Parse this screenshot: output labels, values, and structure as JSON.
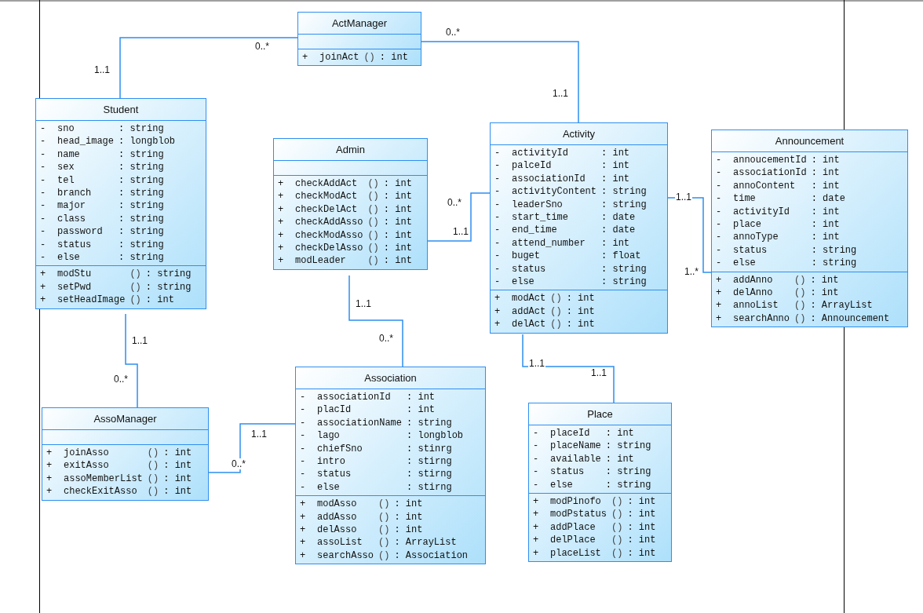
{
  "classes": [
    {
      "name": "ActManager",
      "operations": [
        {
          "visibility": "+",
          "name": "joinAct",
          "params": "()",
          "type": ": int"
        }
      ]
    },
    {
      "name": "Student",
      "attributes": [
        {
          "visibility": "-",
          "name": "sno",
          "type": ": string"
        },
        {
          "visibility": "-",
          "name": "head_image",
          "type": ": longblob"
        },
        {
          "visibility": "-",
          "name": "name",
          "type": ": string"
        },
        {
          "visibility": "-",
          "name": "sex",
          "type": ": string"
        },
        {
          "visibility": "-",
          "name": "tel",
          "type": ": string"
        },
        {
          "visibility": "-",
          "name": "branch",
          "type": ": string"
        },
        {
          "visibility": "-",
          "name": "major",
          "type": ": string"
        },
        {
          "visibility": "-",
          "name": "class",
          "type": ": string"
        },
        {
          "visibility": "-",
          "name": "password",
          "type": ": string"
        },
        {
          "visibility": "-",
          "name": "status",
          "type": ": string"
        },
        {
          "visibility": "-",
          "name": "else",
          "type": ": string"
        }
      ],
      "operations": [
        {
          "visibility": "+",
          "name": "modStu",
          "params": "()",
          "type": ": string"
        },
        {
          "visibility": "+",
          "name": "setPwd",
          "params": "()",
          "type": ": string"
        },
        {
          "visibility": "+",
          "name": "setHeadImage",
          "params": "()",
          "type": ": int"
        }
      ]
    },
    {
      "name": "Admin",
      "operations": [
        {
          "visibility": "+",
          "name": "checkAddAct",
          "params": "()",
          "type": ": int"
        },
        {
          "visibility": "+",
          "name": "checkModAct",
          "params": "()",
          "type": ": int"
        },
        {
          "visibility": "+",
          "name": "checkDelAct",
          "params": "()",
          "type": ": int"
        },
        {
          "visibility": "+",
          "name": "checkAddAsso",
          "params": "()",
          "type": ": int"
        },
        {
          "visibility": "+",
          "name": "checkModAsso",
          "params": "()",
          "type": ": int"
        },
        {
          "visibility": "+",
          "name": "checkDelAsso",
          "params": "()",
          "type": ": int"
        },
        {
          "visibility": "+",
          "name": "modLeader",
          "params": "()",
          "type": ": int"
        }
      ]
    },
    {
      "name": "Activity",
      "attributes": [
        {
          "visibility": "-",
          "name": "activityId",
          "type": ": int"
        },
        {
          "visibility": "-",
          "name": "palceId",
          "type": ": int"
        },
        {
          "visibility": "-",
          "name": "associationId",
          "type": ": int"
        },
        {
          "visibility": "-",
          "name": "activityContent",
          "type": ": string"
        },
        {
          "visibility": "-",
          "name": "leaderSno",
          "type": ": string"
        },
        {
          "visibility": "-",
          "name": "start_time",
          "type": ": date"
        },
        {
          "visibility": "-",
          "name": "end_time",
          "type": ": date"
        },
        {
          "visibility": "-",
          "name": "attend_number",
          "type": ": int"
        },
        {
          "visibility": "-",
          "name": "buget",
          "type": ": float"
        },
        {
          "visibility": "-",
          "name": "status",
          "type": ": string"
        },
        {
          "visibility": "-",
          "name": "else",
          "type": ": string"
        }
      ],
      "operations": [
        {
          "visibility": "+",
          "name": "modAct",
          "params": "()",
          "type": ": int"
        },
        {
          "visibility": "+",
          "name": "addAct",
          "params": "()",
          "type": ": int"
        },
        {
          "visibility": "+",
          "name": "delAct",
          "params": "()",
          "type": ": int"
        }
      ]
    },
    {
      "name": "Announcement",
      "attributes": [
        {
          "visibility": "-",
          "name": "annoucementId",
          "type": ": int"
        },
        {
          "visibility": "-",
          "name": "associationId",
          "type": ": int"
        },
        {
          "visibility": "-",
          "name": "annoContent",
          "type": ": int"
        },
        {
          "visibility": "-",
          "name": "time",
          "type": ": date"
        },
        {
          "visibility": "-",
          "name": "activityId",
          "type": ": int"
        },
        {
          "visibility": "-",
          "name": "place",
          "type": ": int"
        },
        {
          "visibility": "-",
          "name": "annoType",
          "type": ": int"
        },
        {
          "visibility": "-",
          "name": "status",
          "type": ": string"
        },
        {
          "visibility": "-",
          "name": "else",
          "type": ": string"
        }
      ],
      "operations": [
        {
          "visibility": "+",
          "name": "addAnno",
          "params": "()",
          "type": ": int"
        },
        {
          "visibility": "+",
          "name": "delAnno",
          "params": "()",
          "type": ": int"
        },
        {
          "visibility": "+",
          "name": "annoList",
          "params": "()",
          "type": ": ArrayList"
        },
        {
          "visibility": "+",
          "name": "searchAnno",
          "params": "()",
          "type": ": Announcement"
        }
      ]
    },
    {
      "name": "AssoManager",
      "operations": [
        {
          "visibility": "+",
          "name": "joinAsso",
          "params": "()",
          "type": ": int"
        },
        {
          "visibility": "+",
          "name": "exitAsso",
          "params": "()",
          "type": ": int"
        },
        {
          "visibility": "+",
          "name": "assoMemberList",
          "params": "()",
          "type": ": int"
        },
        {
          "visibility": "+",
          "name": "checkExitAsso",
          "params": "()",
          "type": ": int"
        }
      ]
    },
    {
      "name": "Association",
      "attributes": [
        {
          "visibility": "-",
          "name": "associationId",
          "type": ": int"
        },
        {
          "visibility": "-",
          "name": "placId",
          "type": ": int"
        },
        {
          "visibility": "-",
          "name": "associationName",
          "type": ": string"
        },
        {
          "visibility": "-",
          "name": "lago",
          "type": ": longblob"
        },
        {
          "visibility": "-",
          "name": "chiefSno",
          "type": ": stinrg"
        },
        {
          "visibility": "-",
          "name": "intro",
          "type": ": stirng"
        },
        {
          "visibility": "-",
          "name": "status",
          "type": ": stirng"
        },
        {
          "visibility": "-",
          "name": "else",
          "type": ": stirng"
        }
      ],
      "operations": [
        {
          "visibility": "+",
          "name": "modAsso",
          "params": "()",
          "type": ": int"
        },
        {
          "visibility": "+",
          "name": "addAsso",
          "params": "()",
          "type": ": int"
        },
        {
          "visibility": "+",
          "name": "delAsso",
          "params": "()",
          "type": ": int"
        },
        {
          "visibility": "+",
          "name": "assoList",
          "params": "()",
          "type": ": ArrayList"
        },
        {
          "visibility": "+",
          "name": "searchAsso",
          "params": "()",
          "type": ": Association"
        }
      ]
    },
    {
      "name": "Place",
      "attributes": [
        {
          "visibility": "-",
          "name": "placeId",
          "type": ": int"
        },
        {
          "visibility": "-",
          "name": "placeName",
          "type": ": string"
        },
        {
          "visibility": "-",
          "name": "available",
          "type": ": int"
        },
        {
          "visibility": "-",
          "name": "status",
          "type": ": string"
        },
        {
          "visibility": "-",
          "name": "else",
          "type": ": string"
        }
      ],
      "operations": [
        {
          "visibility": "+",
          "name": "modPinofo",
          "params": "()",
          "type": ": int"
        },
        {
          "visibility": "+",
          "name": "modPstatus",
          "params": "()",
          "type": ": int"
        },
        {
          "visibility": "+",
          "name": "addPlace",
          "params": "()",
          "type": ": int"
        },
        {
          "visibility": "+",
          "name": "delPlace",
          "params": "()",
          "type": ": int"
        },
        {
          "visibility": "+",
          "name": "placeList",
          "params": "()",
          "type": ": int"
        }
      ]
    }
  ],
  "associations": [
    {
      "multiplicities": [
        "1..1",
        "0..*"
      ]
    },
    {
      "multiplicities": [
        "0..*",
        "1..1"
      ]
    },
    {
      "multiplicities": [
        "0..*",
        "1..1"
      ]
    },
    {
      "multiplicities": [
        "1..1",
        "1..*"
      ]
    },
    {
      "multiplicities": [
        "1..1",
        "0..*"
      ]
    },
    {
      "multiplicities": [
        "1..1",
        "0..*"
      ]
    },
    {
      "multiplicities": [
        "1..1",
        "0..*"
      ]
    },
    {
      "multiplicities": [
        "1..1",
        "1..1"
      ]
    }
  ]
}
